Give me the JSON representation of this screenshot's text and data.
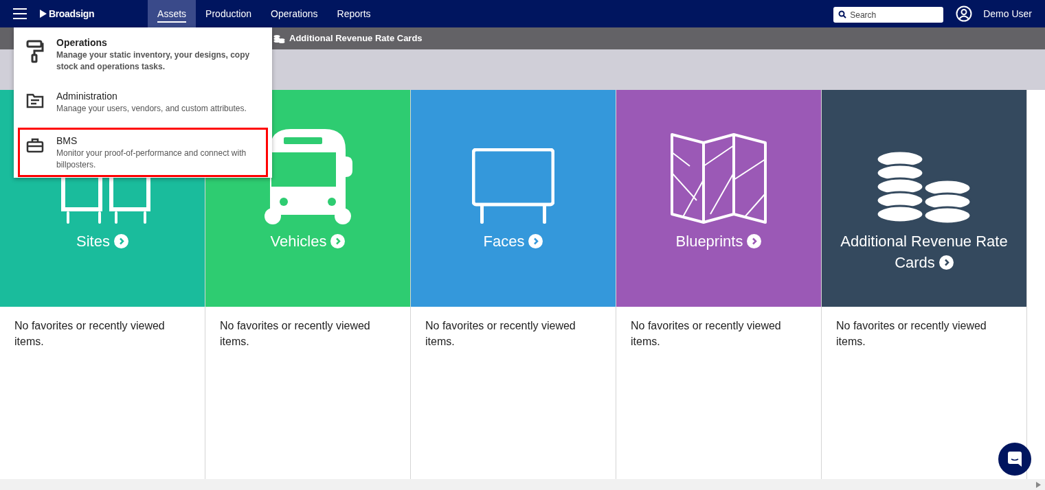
{
  "top_nav": {
    "logo": "Broadsign",
    "menus": [
      {
        "label": "Assets",
        "selected": true
      },
      {
        "label": "Production",
        "selected": false
      },
      {
        "label": "Operations",
        "selected": false
      },
      {
        "label": "Reports",
        "selected": false
      }
    ],
    "search": {
      "placeholder": "Search"
    },
    "user": "Demo User"
  },
  "sub_nav": {
    "items": [
      "Additional Revenue Rate Cards"
    ]
  },
  "dropdown": {
    "items": [
      {
        "kind": "roller",
        "title": "Operations",
        "description": "Manage your static inventory, your designs, copy stock and operations tasks.",
        "bold": true,
        "highlighted": false
      },
      {
        "kind": "folder",
        "title": "Administration",
        "description": "Manage your users, vendors, and custom attributes.",
        "bold": false,
        "highlighted": false
      },
      {
        "kind": "toolbox",
        "title": "BMS",
        "description": "Monitor your proof-of-performance and connect with billposters.",
        "bold": false,
        "highlighted": true
      }
    ]
  },
  "tiles": [
    {
      "kind": "sites",
      "title": "Sites",
      "color": "#1abc9c",
      "empty_text": "No favorites or recently viewed items."
    },
    {
      "kind": "vehicles",
      "title": "Vehicles",
      "color": "#2ecc71",
      "empty_text": "No favorites or recently viewed items."
    },
    {
      "kind": "faces",
      "title": "Faces",
      "color": "#3498db",
      "empty_text": "No favorites or recently viewed items."
    },
    {
      "kind": "blueprints",
      "title": "Blueprints",
      "color": "#9b59b6",
      "empty_text": "No favorites or recently viewed items."
    },
    {
      "kind": "coins",
      "title": "Additional Revenue Rate Cards",
      "color": "#34495e",
      "empty_text": "No favorites or recently viewed items."
    }
  ]
}
